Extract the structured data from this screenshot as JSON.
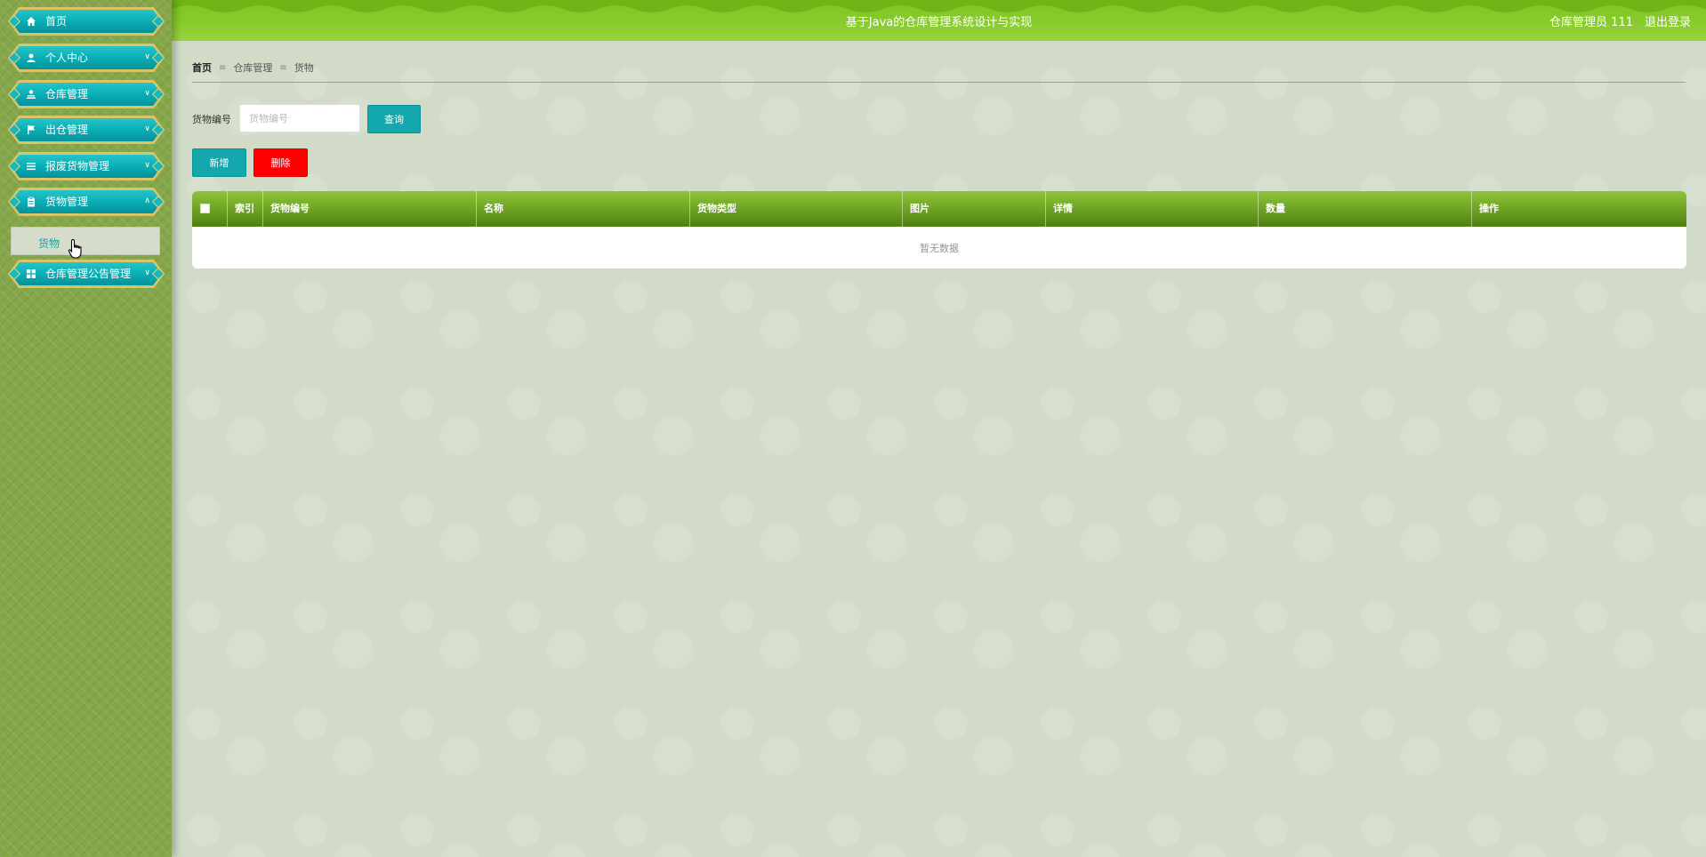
{
  "app": {
    "title": "基于Java的仓库管理系统设计与实现",
    "user": "仓库管理员 111",
    "logout": "退出登录"
  },
  "sidebar": {
    "items": [
      {
        "label": "首页",
        "icon": "home-icon",
        "arrow": ""
      },
      {
        "label": "个人中心",
        "icon": "user-icon",
        "arrow": "chevron-down"
      },
      {
        "label": "仓库管理",
        "icon": "warehouse-icon",
        "arrow": "chevron-down"
      },
      {
        "label": "出仓管理",
        "icon": "flag-icon",
        "arrow": "chevron-down"
      },
      {
        "label": "报废货物管理",
        "icon": "list-icon",
        "arrow": "chevron-down"
      },
      {
        "label": "货物管理",
        "icon": "clipboard-icon",
        "arrow": "chevron-up"
      },
      {
        "label": "仓库管理公告管理",
        "icon": "grid-icon",
        "arrow": "chevron-down"
      }
    ],
    "submenu": {
      "label": "货物"
    }
  },
  "breadcrumb": {
    "items": [
      "首页",
      "仓库管理",
      "货物"
    ]
  },
  "search": {
    "label": "货物编号",
    "placeholder": "货物编号",
    "value": "",
    "button": "查询"
  },
  "actions": {
    "add": "新增",
    "delete": "删除"
  },
  "table": {
    "columns": [
      "索引",
      "货物编号",
      "名称",
      "货物类型",
      "图片",
      "详情",
      "数量",
      "操作"
    ],
    "rows": [],
    "empty_text": "暂无数据"
  },
  "colors": {
    "topbar": "#88cc2c",
    "menu_teal": "#0bb1b8",
    "table_header": "#72a726",
    "delete_red": "#ff0000"
  }
}
